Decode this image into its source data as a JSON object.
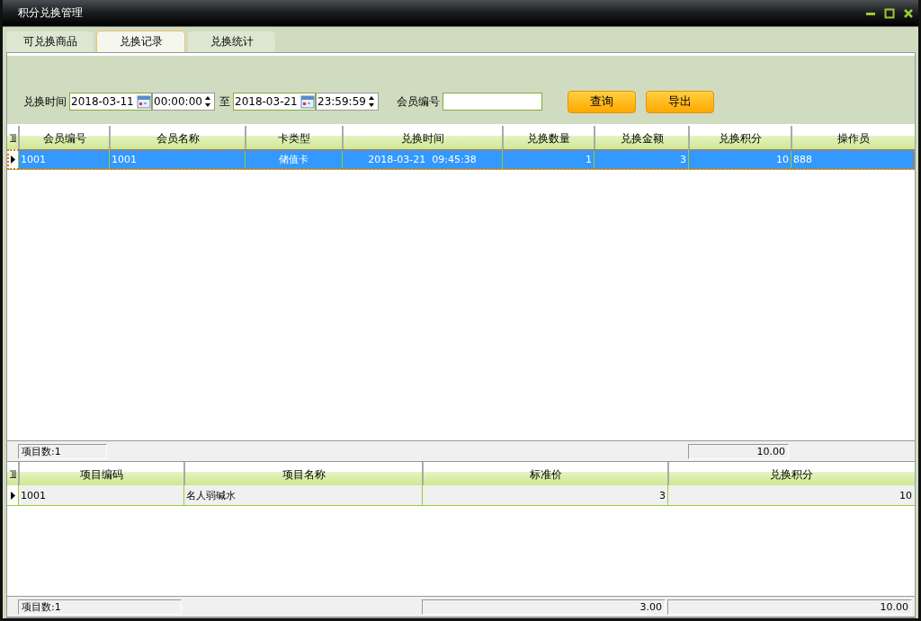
{
  "window": {
    "title": "积分兑换管理"
  },
  "tabs": [
    {
      "label": "可兑换商品",
      "selected": false
    },
    {
      "label": "兑换记录",
      "selected": true
    },
    {
      "label": "兑换统计",
      "selected": false
    }
  ],
  "filter": {
    "time_label": "兑换时间",
    "start_date": "2018-03-11",
    "start_time": "00:00:00",
    "to_label": "至",
    "end_date": "2018-03-21",
    "end_time": "23:59:59",
    "member_label": "会员编号",
    "buttons": [
      "查询",
      "导出"
    ]
  },
  "records": {
    "columns": [
      "会员编号",
      "会员名称",
      "卡类型",
      "兑换时间",
      "兑换数量",
      "兑换金额",
      "兑换积分",
      "操作员"
    ],
    "rows": [
      {
        "cells": [
          "1001",
          "1001",
          "储值卡",
          "2018-03-21  09:45:38",
          "1",
          "3",
          "10",
          "888"
        ],
        "selected": true,
        "current": true
      }
    ],
    "footer": {
      "count": "项目数:1",
      "points_total": "10.00"
    }
  },
  "items": {
    "columns": [
      "项目编码",
      "项目名称",
      "标准价",
      "兑换积分"
    ],
    "rows": [
      {
        "cells": [
          "1001",
          "名人弱碱水",
          "3",
          "10"
        ],
        "selected": false,
        "current": true
      }
    ],
    "footer": {
      "count": "项目数:1",
      "price_total": "3.00",
      "points_total": "10.00"
    }
  }
}
